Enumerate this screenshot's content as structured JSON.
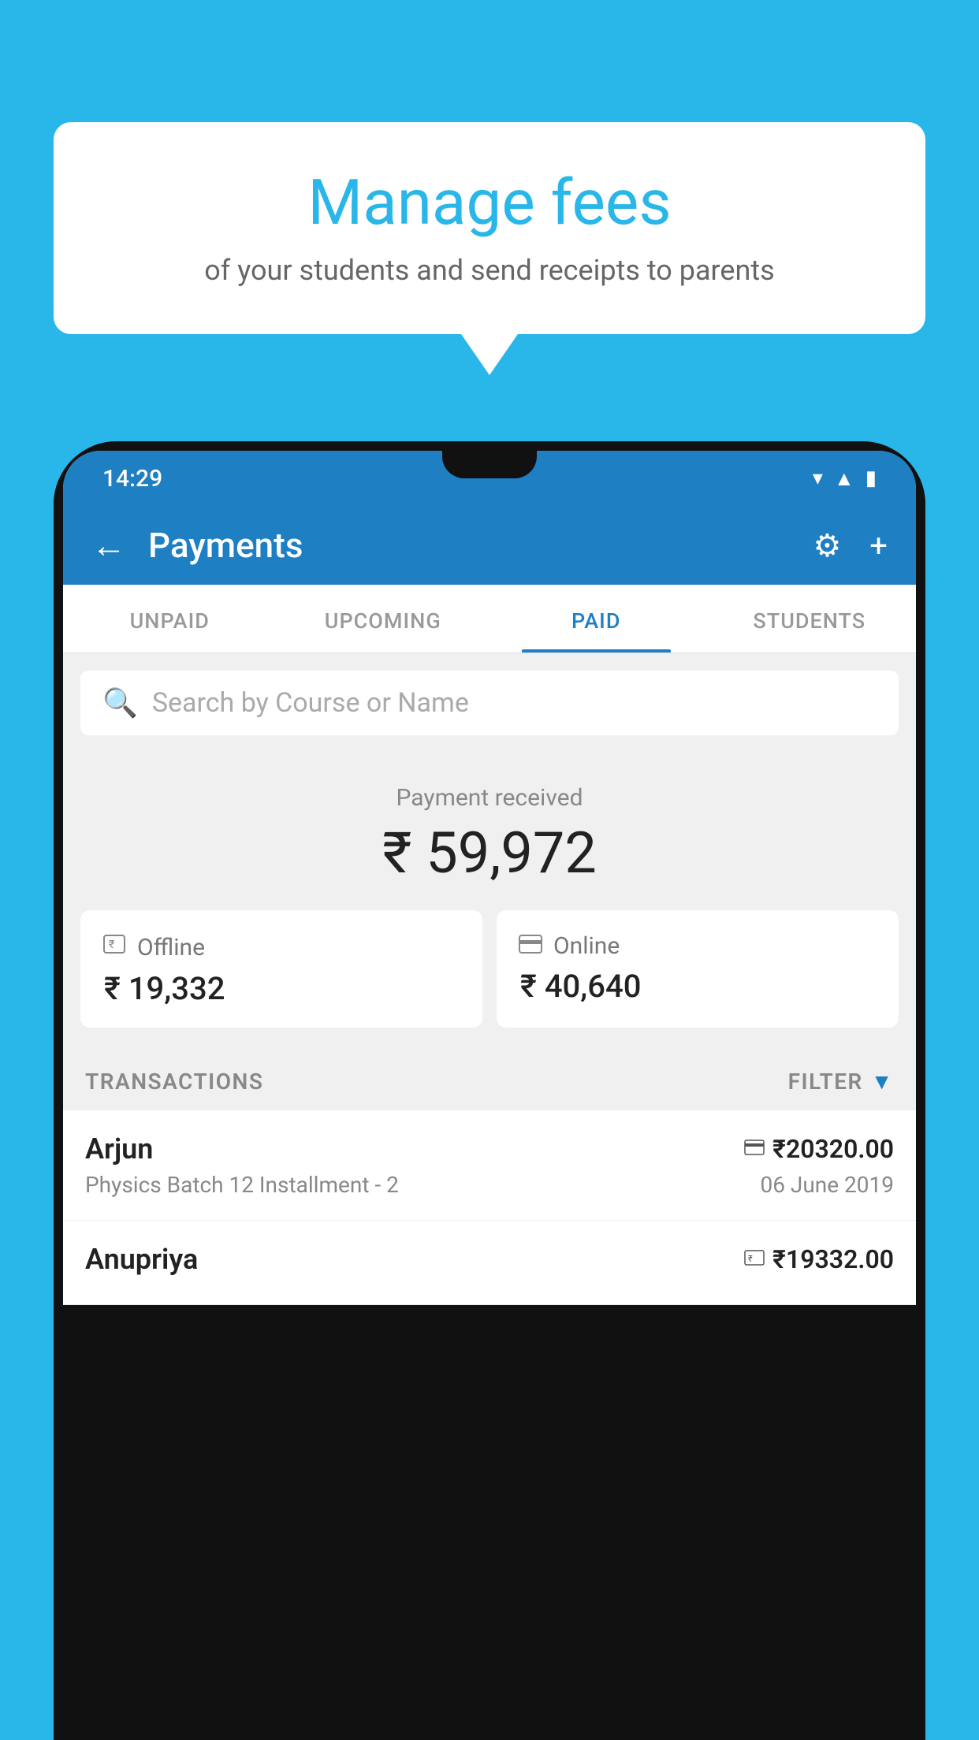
{
  "background_color": "#29b6e8",
  "bubble": {
    "title": "Manage fees",
    "subtitle": "of your students and send receipts to parents"
  },
  "status_bar": {
    "time": "14:29",
    "icons": [
      "wifi",
      "signal",
      "battery"
    ]
  },
  "app_bar": {
    "title": "Payments",
    "back_label": "←",
    "settings_icon": "⚙",
    "add_icon": "+"
  },
  "tabs": [
    {
      "label": "UNPAID",
      "active": false
    },
    {
      "label": "UPCOMING",
      "active": false
    },
    {
      "label": "PAID",
      "active": true
    },
    {
      "label": "STUDENTS",
      "active": false
    }
  ],
  "search": {
    "placeholder": "Search by Course or Name"
  },
  "payment_received": {
    "label": "Payment received",
    "amount": "₹ 59,972"
  },
  "cards": [
    {
      "icon": "💳",
      "type": "Offline",
      "amount": "₹ 19,332"
    },
    {
      "icon": "💳",
      "type": "Online",
      "amount": "₹ 40,640"
    }
  ],
  "transactions_label": "TRANSACTIONS",
  "filter_label": "FILTER",
  "transactions": [
    {
      "name": "Arjun",
      "payment_icon": "💳",
      "amount": "₹20320.00",
      "batch": "Physics Batch 12 Installment - 2",
      "date": "06 June 2019"
    },
    {
      "name": "Anupriya",
      "payment_icon": "💵",
      "amount": "₹19332.00",
      "batch": "",
      "date": ""
    }
  ]
}
